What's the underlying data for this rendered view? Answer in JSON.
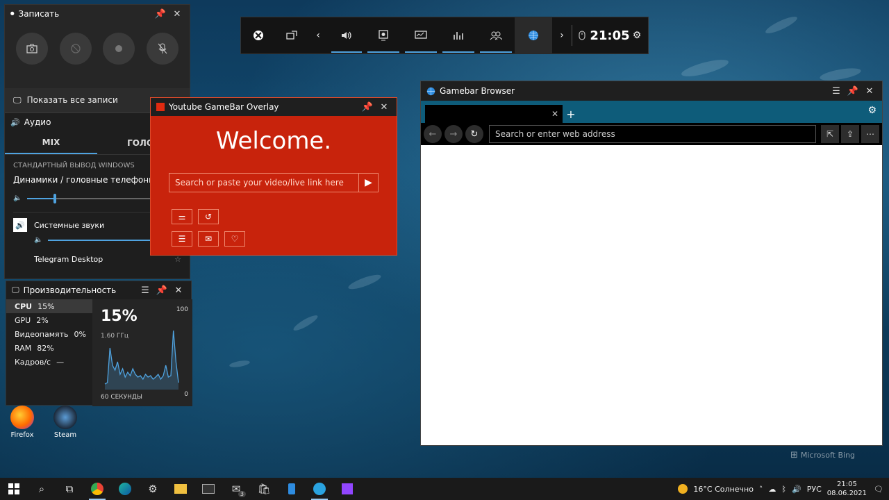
{
  "colors": {
    "accent": "#4fa3e0",
    "youtube_red": "#c8230c",
    "browser_teal": "#0e5c7a"
  },
  "xbox_bar": {
    "items": [
      "xbox-icon",
      "widget-store-icon",
      "chevron-left-icon",
      "audio-icon",
      "capture-icon",
      "performance-icon",
      "resources-icon",
      "social-icon",
      "browser-globe-icon",
      "chevron-right-icon",
      "mouse-icon"
    ],
    "time": "21:05"
  },
  "record": {
    "title": "Записать",
    "show_all": "Показать все записи",
    "buttons": [
      "camera-icon",
      "last-seconds-icon",
      "record-icon",
      "mic-off-icon"
    ]
  },
  "audio": {
    "title": "Аудио",
    "tabs": [
      "MIX",
      "ГОЛОС"
    ],
    "section": "СТАНДАРТНЫЙ ВЫВОД WINDOWS",
    "device": "Динамики / головные телефоны (Realtek)",
    "device_volume": 0.18,
    "apps": [
      {
        "name": "Системные звуки",
        "volume": 1.0
      },
      {
        "name": "Telegram Desktop"
      }
    ]
  },
  "performance": {
    "title": "Производительность",
    "items": [
      {
        "label": "CPU",
        "value": "15%"
      },
      {
        "label": "GPU",
        "value": "2%"
      },
      {
        "label": "Видеопамять",
        "value": "0%"
      },
      {
        "label": "RAM",
        "value": "82%"
      },
      {
        "label": "Кадров/с",
        "value": "—"
      }
    ],
    "big_value": "15%",
    "freq": "1.60 ГГц",
    "axis_top": "100",
    "axis_bottom": "0",
    "axis_label": "60 СЕКУНДЫ",
    "series": [
      8,
      10,
      60,
      35,
      28,
      40,
      22,
      30,
      18,
      25,
      20,
      30,
      22,
      18,
      20,
      15,
      22,
      18,
      20,
      15,
      18,
      22,
      15,
      20,
      35,
      18,
      20,
      85,
      40,
      10
    ]
  },
  "youtube": {
    "title": "Youtube GameBar Overlay",
    "welcome": "Welcome.",
    "search_placeholder": "Search or paste your video/live link here",
    "icons": [
      "sliders-icon",
      "history-icon",
      "list-icon",
      "mail-icon",
      "heart-icon"
    ]
  },
  "browser": {
    "title": "Gamebar Browser",
    "url_placeholder": "Search or enter web address"
  },
  "desktop": {
    "icons": [
      {
        "label": "Firefox"
      },
      {
        "label": "Steam"
      }
    ],
    "bing": "Microsoft Bing"
  },
  "taskbar": {
    "weather": "16°C  Солнечно",
    "lang": "РУС",
    "time": "21:05",
    "date": "08.06.2021",
    "mail_badge": "3"
  }
}
